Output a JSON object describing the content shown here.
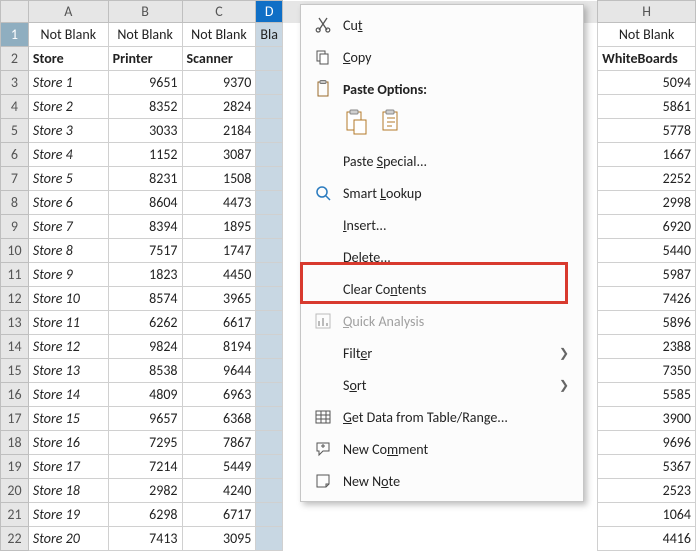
{
  "columns": [
    "A",
    "B",
    "C",
    "D",
    "H"
  ],
  "header_row": [
    "Not Blank",
    "Not Blank",
    "Not Blank",
    "Bla",
    "Not Blank"
  ],
  "title_row": [
    "Store",
    "Printer",
    "Scanner",
    "",
    "WhiteBoards"
  ],
  "rows": [
    {
      "n": 3,
      "store": "Store 1",
      "printer": 9651,
      "scanner": 9370,
      "wb": 5094
    },
    {
      "n": 4,
      "store": "Store 2",
      "printer": 8352,
      "scanner": 2824,
      "wb": 5861
    },
    {
      "n": 5,
      "store": "Store 3",
      "printer": 3033,
      "scanner": 2184,
      "wb": 5778
    },
    {
      "n": 6,
      "store": "Store 4",
      "printer": 1152,
      "scanner": 3087,
      "wb": 1667
    },
    {
      "n": 7,
      "store": "Store 5",
      "printer": 8231,
      "scanner": 1508,
      "wb": 2252
    },
    {
      "n": 8,
      "store": "Store 6",
      "printer": 8604,
      "scanner": 4473,
      "wb": 2998
    },
    {
      "n": 9,
      "store": "Store 7",
      "printer": 8394,
      "scanner": 1895,
      "wb": 6920
    },
    {
      "n": 10,
      "store": "Store 8",
      "printer": 7517,
      "scanner": 1747,
      "wb": 5440
    },
    {
      "n": 11,
      "store": "Store 9",
      "printer": 1823,
      "scanner": 4450,
      "wb": 5987
    },
    {
      "n": 12,
      "store": "Store 10",
      "printer": 8574,
      "scanner": 3965,
      "wb": 7426
    },
    {
      "n": 13,
      "store": "Store 11",
      "printer": 6262,
      "scanner": 6617,
      "wb": 5896
    },
    {
      "n": 14,
      "store": "Store 12",
      "printer": 9824,
      "scanner": 8194,
      "wb": 2388
    },
    {
      "n": 15,
      "store": "Store 13",
      "printer": 8538,
      "scanner": 9644,
      "wb": 7350
    },
    {
      "n": 16,
      "store": "Store 14",
      "printer": 4809,
      "scanner": 6963,
      "wb": 5585
    },
    {
      "n": 17,
      "store": "Store 15",
      "printer": 9657,
      "scanner": 6368,
      "wb": 3900
    },
    {
      "n": 18,
      "store": "Store 16",
      "printer": 7295,
      "scanner": 7867,
      "wb": 9696
    },
    {
      "n": 19,
      "store": "Store 17",
      "printer": 7214,
      "scanner": 5449,
      "wb": 5367
    },
    {
      "n": 20,
      "store": "Store 18",
      "printer": 2982,
      "scanner": 4240,
      "wb": 2523
    },
    {
      "n": 21,
      "store": "Store 19",
      "printer": 6298,
      "scanner": 6717,
      "wb": 1064
    },
    {
      "n": 22,
      "store": "Store 20",
      "printer": 7413,
      "scanner": 3095,
      "wb": 4416
    }
  ],
  "menu": {
    "cut": "Cut",
    "copy": "Copy",
    "paste_options": "Paste Options:",
    "paste_special": "Paste Special...",
    "smart_lookup": "Smart Lookup",
    "insert": "Insert...",
    "delete": "Delete...",
    "clear_contents": "Clear Contents",
    "quick_analysis": "Quick Analysis",
    "filter": "Filter",
    "sort": "Sort",
    "get_data": "Get Data from Table/Range...",
    "new_comment": "New Comment",
    "new_note": "New Note"
  }
}
